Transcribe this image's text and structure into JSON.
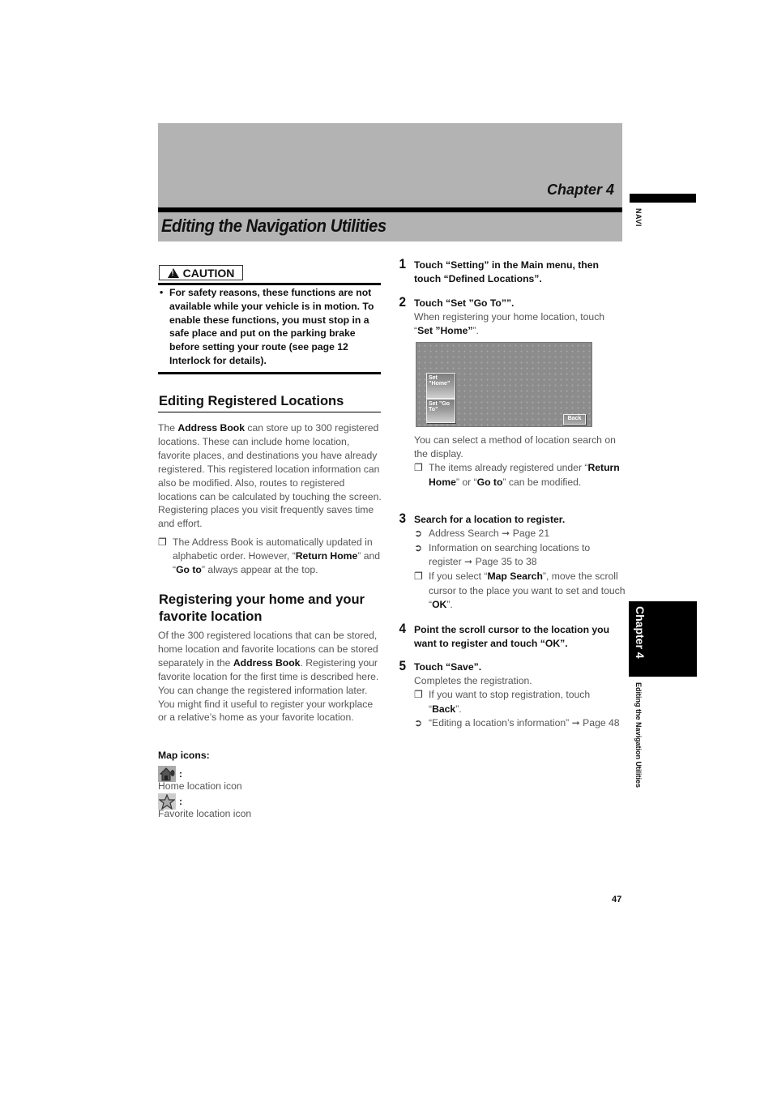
{
  "header": {
    "chapter": "Chapter 4",
    "title": "Editing the Navigation Utilities"
  },
  "side_tab": {
    "section": "NAVI",
    "chapter": "Chapter 4",
    "title": "Editing the Navigation Utilities"
  },
  "caution": {
    "label": "CAUTION",
    "bullet": "•",
    "text": "For safety reasons, these functions are not available while your vehicle is in motion. To enable these functions, you must stop in a safe place and put on the parking brake before setting your route (see page 12 Interlock for details)."
  },
  "section1": {
    "heading": "Editing Registered Locations",
    "para": {
      "pre": "The ",
      "bold": "Address Book",
      "post": " can store up to 300 registered locations. These can include home location, favorite places, and destinations you have already registered. This registered location information can also be modified. Also, routes to registered locations can be calculated by touching the screen. Registering places you visit frequently saves time and effort."
    },
    "note": {
      "mark": "❐",
      "t1": "The Address Book is automatically updated in alphabetic order. However, “",
      "b1": "Return Home",
      "t2": "” and “",
      "b2": "Go to",
      "t3": "” always appear at the top."
    }
  },
  "section2": {
    "heading": "Registering your home and your favorite location",
    "para": {
      "pre": "Of the 300 registered locations that can be stored, home location and favorite locations can be stored separately in the ",
      "bold": "Address Book",
      "post": ". Registering your favorite location for the first time is described here. You can change the registered information later. You might find it useful to register your workplace or a relative’s home as your favorite location."
    },
    "map_icons_title": "Map icons:",
    "icons": [
      {
        "icon": "home-icon",
        "colon": ":",
        "caption": "Home location icon"
      },
      {
        "icon": "star-icon",
        "colon": ":",
        "caption": "Favorite location icon"
      }
    ]
  },
  "steps": [
    {
      "num": "1",
      "head": "Touch “Setting” in the Main menu, then touch “Defined Locations”."
    },
    {
      "num": "2",
      "head": "Touch “Set ”Go To””.",
      "sub_pre": "When registering your home location, touch “",
      "sub_bold": "Set ”Home”",
      "sub_post": "”."
    },
    {
      "num": "3",
      "head": "Search for a location to register."
    },
    {
      "num": "4",
      "head": "Point the scroll cursor to the location you want to register and touch “OK”."
    },
    {
      "num": "5",
      "head": "Touch “Save”.",
      "sub": "Completes the registration."
    }
  ],
  "screen": {
    "set_home": "Set ”Home”",
    "set_goto": "Set ”Go To”",
    "back": "Back"
  },
  "step2_after": {
    "text": "You can select a method of location search on the display.",
    "note": {
      "mark": "❐",
      "t1": "The items already registered under “",
      "b1": "Return Home",
      "t2": "” or “",
      "b2": "Go to",
      "t3": "” can be modified."
    }
  },
  "step3_items": [
    {
      "mark": "➲",
      "text": "Address Search ➞ Page 21"
    },
    {
      "mark": "➲",
      "text": "Information on searching locations to register ➞ Page 35 to 38"
    },
    {
      "mark": "❐",
      "t1": "If you select “",
      "b1": "Map Search",
      "t2": "”, move the scroll cursor to the place you want to set and touch “",
      "b2": "OK",
      "t3": "”."
    }
  ],
  "step5_items": [
    {
      "mark": "❐",
      "t1": "If you want to stop registration, touch “",
      "b1": "Back",
      "t2": "”."
    },
    {
      "mark": "➲",
      "text": "“Editing a location’s information” ➞ Page 48"
    }
  ],
  "page_number": "47"
}
